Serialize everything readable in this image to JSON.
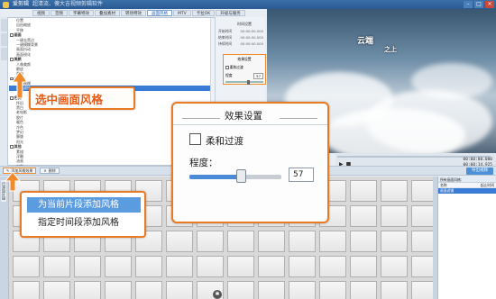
{
  "app": {
    "title": "爱剪辑",
    "subtitle": "超清流、傻大吉视频剪辑软件"
  },
  "menu": [
    "视频",
    "音频",
    "字幕特效",
    "叠加素材",
    "转场特效",
    "画面风格",
    "MTV",
    "卡拉OK",
    "升级与服务"
  ],
  "active_tab": "画面风格",
  "tree": [
    {
      "t": "位置",
      "k": "sub"
    },
    {
      "t": "自由缩放",
      "k": "sub"
    },
    {
      "t": "平移",
      "k": "sub"
    },
    {
      "t": "画面",
      "k": "grp"
    },
    {
      "t": "一键去黑边",
      "k": "sub"
    },
    {
      "t": "一键模糊背景",
      "k": "sub"
    },
    {
      "t": "画面抖动",
      "k": "sub"
    },
    {
      "t": "画面锐化",
      "k": "sub"
    },
    {
      "t": "美颜",
      "k": "grp"
    },
    {
      "t": "人像美颜",
      "k": "sub"
    },
    {
      "t": "磨皮",
      "k": "sub"
    },
    {
      "t": "美白",
      "k": "sub"
    },
    {
      "t": "动景",
      "k": "grp"
    },
    {
      "t": "动态模糊",
      "k": "sub"
    },
    {
      "t": "画面滤镜",
      "k": "sel"
    },
    {
      "t": "光晕",
      "k": "sub"
    },
    {
      "t": "色调",
      "k": "grp"
    },
    {
      "t": "怀旧",
      "k": "sub"
    },
    {
      "t": "黑白",
      "k": "sub"
    },
    {
      "t": "老电影",
      "k": "sub"
    },
    {
      "t": "胶片",
      "k": "sub"
    },
    {
      "t": "暖色",
      "k": "sub"
    },
    {
      "t": "冷色",
      "k": "sub"
    },
    {
      "t": "梦幻",
      "k": "sub"
    },
    {
      "t": "朦胧",
      "k": "sub"
    },
    {
      "t": "阳光",
      "k": "sub"
    },
    {
      "t": "其他",
      "k": "grp"
    },
    {
      "t": "素描",
      "k": "sub"
    },
    {
      "t": "浮雕",
      "k": "sub"
    },
    {
      "t": "油画",
      "k": "sub"
    },
    {
      "t": "水彩",
      "k": "sub"
    },
    {
      "t": "铅笔画",
      "k": "sub"
    }
  ],
  "params": {
    "header": "时间设置",
    "start_label": "开始时间",
    "start_val": "00:00:00.000",
    "end_label": "结束时间",
    "end_val": "00:00:00.000",
    "dur_label": "持续时间",
    "dur_val": "00:00:00.000",
    "section": "效果设置",
    "small_cb": "柔和过渡",
    "small_lvl": "程度",
    "small_val": "57"
  },
  "preview": {
    "caption1": "云端",
    "caption2": "之上"
  },
  "player": {
    "time1": "00:00:00.000",
    "time2": "00:00:14.925"
  },
  "controls": {
    "add_style": "添加风格效果",
    "delete": "删除",
    "export": "导出视频"
  },
  "vtab": "已添加片段",
  "right_panel": {
    "title": "所有画面风格：",
    "col1": "名称",
    "col2": "起止时间",
    "row1": "画面滤镜"
  },
  "callouts": {
    "select_style": "选中画面风格",
    "fx_title": "效果设置",
    "soft_transition": "柔和过渡",
    "degree": "程度：",
    "degree_value": "57",
    "degree_fraction": 0.56,
    "add_current": "为当前片段添加风格",
    "add_range": "指定时间段添加风格"
  }
}
